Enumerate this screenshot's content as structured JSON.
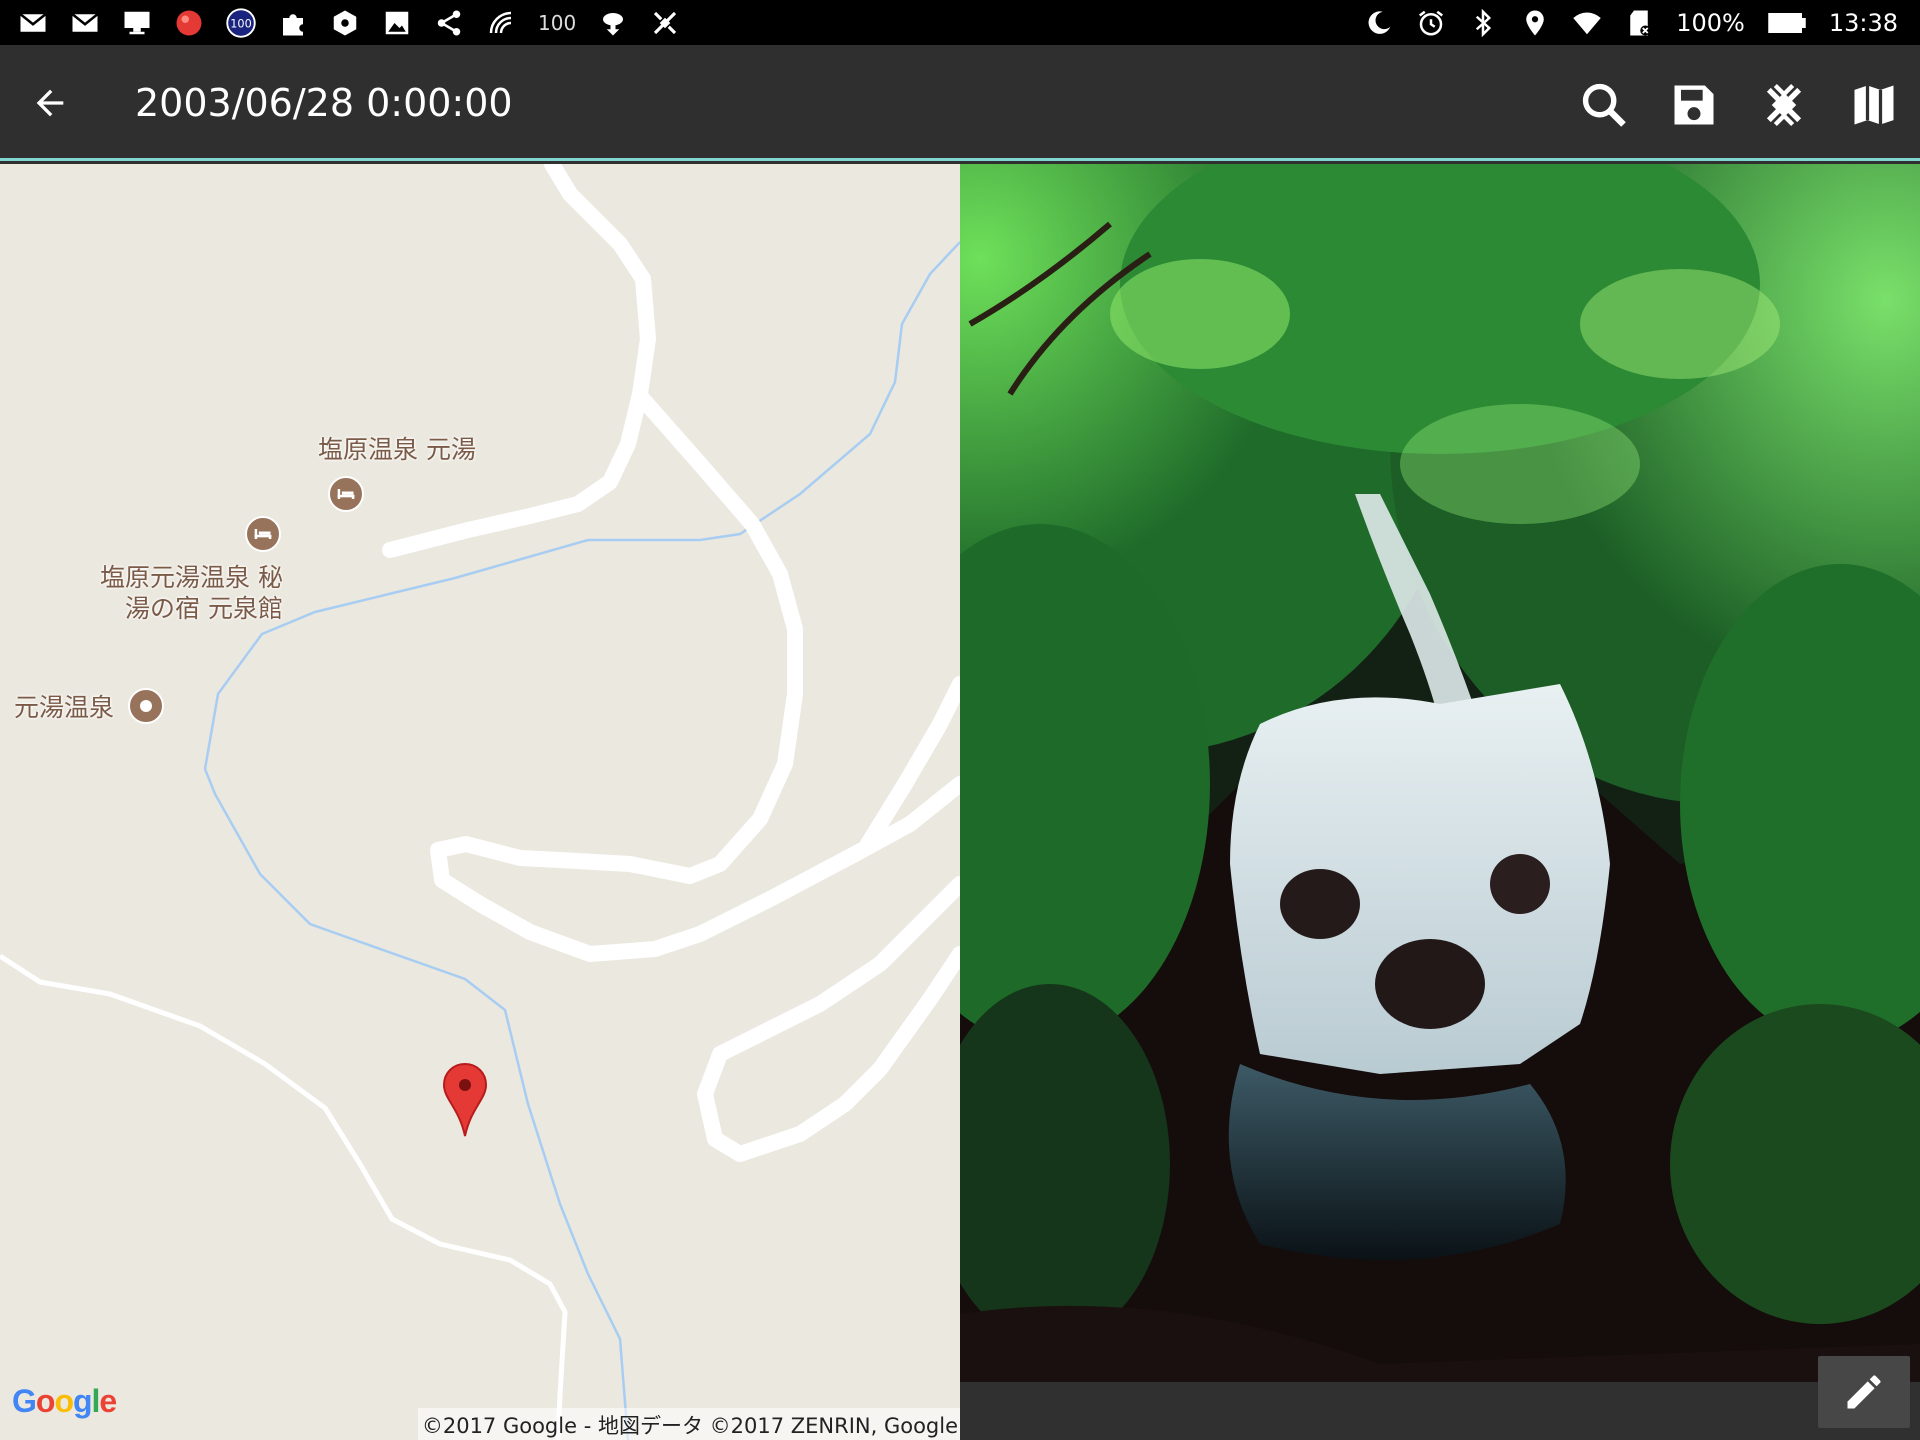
{
  "status_bar": {
    "left_icons": [
      "gmail-icon",
      "gmail-icon",
      "desktop-icon",
      "red-ball-icon",
      "badge-100-icon",
      "puzzle-icon",
      "hexagon-icon",
      "image-icon",
      "share-icon",
      "signal-wave-icon"
    ],
    "signal_text": "100",
    "battery_percent": "100%",
    "time": "13:38",
    "right_icons": [
      "moon-icon",
      "alarm-icon",
      "bluetooth-icon",
      "location-icon",
      "wifi-icon",
      "sd-card-icon"
    ]
  },
  "toolbar": {
    "title": "2003/06/28 0:00:00",
    "actions": [
      "search-icon",
      "save-icon",
      "gps-off-icon",
      "map-icon"
    ],
    "accent_color": "#7fd6cf"
  },
  "map": {
    "labels": {
      "poi1": "塩原温泉 元湯",
      "poi2_line1": "塩原元湯温泉 秘",
      "poi2_line2": "湯の宿 元泉館",
      "poi3": "元湯温泉"
    },
    "google": [
      "G",
      "o",
      "o",
      "g",
      "l",
      "e"
    ],
    "google_colors": [
      "#4285f4",
      "#ea4335",
      "#fbbc05",
      "#4285f4",
      "#34a853",
      "#ea4335"
    ],
    "copyright": "©2017 Google - 地図データ ©2017 ZENRIN, Google",
    "marker_color": "#e53935"
  },
  "photo": {
    "subject": "waterfall-forest-photo"
  },
  "bottom": {
    "edit_icon": "pencil-icon"
  }
}
